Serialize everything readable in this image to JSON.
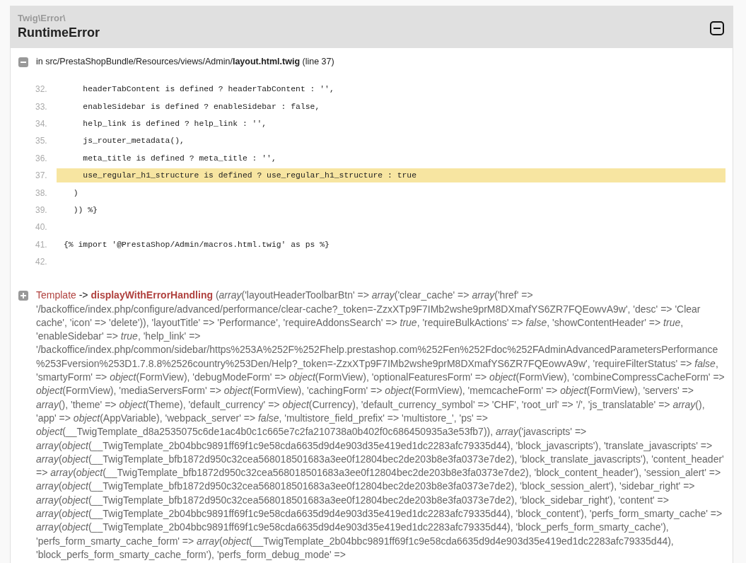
{
  "exception": {
    "namespace": "Twig\\Error\\",
    "class": "RuntimeError",
    "expanded": true
  },
  "trace": [
    {
      "kind": "file",
      "expanded": true,
      "location": "in src/PrestaShopBundle/Resources/views/Admin/**layout.html.twig** (line 37)",
      "code": [
        {
          "number": "32.",
          "text": "    headerTabContent is defined ? headerTabContent : '',",
          "selected": false
        },
        {
          "number": "33.",
          "text": "    enableSidebar is defined ? enableSidebar : false,",
          "selected": false
        },
        {
          "number": "34.",
          "text": "    help_link is defined ? help_link : '',",
          "selected": false
        },
        {
          "number": "35.",
          "text": "    js_router_metadata(),",
          "selected": false
        },
        {
          "number": "36.",
          "text": "    meta_title is defined ? meta_title : '',",
          "selected": false
        },
        {
          "number": "37.",
          "text": "    use_regular_h1_structure is defined ? use_regular_h1_structure : true",
          "selected": true
        },
        {
          "number": "38.",
          "text": "  )",
          "selected": false
        },
        {
          "number": "39.",
          "text": "  )) %}",
          "selected": false
        },
        {
          "number": "40.",
          "selected": false
        },
        {
          "number": "41.",
          "text": "{% import '@PrestaShop/Admin/macros.html.twig' as ps %}",
          "selected": false
        },
        {
          "number": "42.",
          "selected": false
        }
      ]
    },
    {
      "kind": "call",
      "expanded": false,
      "class": "Template",
      "arrow": "->",
      "method": "displayWithErrorHandling",
      "args": "(*array*('layoutHeaderToolbarBtn' => *array*('clear_cache' => *array*('href' => '/backoffice/index.php/configure/advanced/performance/clear-cache?_token=-ZzxXTp9F7IMb2wshe9prM8DXmafYS6ZR7FQEowvA9w', 'desc' => 'Clear cache', 'icon' => 'delete')), 'layoutTitle' => 'Performance', 'requireAddonsSearch' => *true*, 'requireBulkActions' => *false*, 'showContentHeader' => *true*, 'enableSidebar' => *true*, 'help_link' => '/backoffice/index.php/common/sidebar/https%253A%252F%252Fhelp.prestashop.com%252Fen%252Fdoc%252FAdminAdvancedParametersPerformance%253Fversion%253D1.7.8.8%2526country%253Den/Help?_token=-ZzxXTp9F7IMb2wshe9prM8DXmafYS6ZR7FQEowvA9w', 'requireFilterStatus' => *false*, 'smartyForm' => *object*(FormView), 'debugModeForm' => *object*(FormView), 'optionalFeaturesForm' => *object*(FormView), 'combineCompressCacheForm' => *object*(FormView), 'mediaServersForm' => *object*(FormView), 'cachingForm' => *object*(FormView), 'memcacheForm' => *object*(FormView), 'servers' => *array*(), 'theme' => *object*(Theme), 'default_currency' => *object*(Currency), 'default_currency_symbol' => 'CHF', 'root_url' => '/', 'js_translatable' => *array*(), 'app' => *object*(AppVariable), 'webpack_server' => *false*, 'multistore_field_prefix' => 'multistore_', 'ps' => *object*(__TwigTemplate_d8a2535075c6de1ac4b0c1c665e7c2fa210738a0b402f0c686450935a3e53fb7)), *array*('javascripts' => *array*(*object*(__TwigTemplate_2b04bbc9891ff69f1c9e58cda6635d9d4e903d35e419ed1dc2283afc79335d44), 'block_javascripts'), 'translate_javascripts' => *array*(*object*(__TwigTemplate_bfb1872d950c32cea568018501683a3ee0f12804bec2de203b8e3fa0373e7de2), 'block_translate_javascripts'), 'content_header' => *array*(*object*(__TwigTemplate_bfb1872d950c32cea568018501683a3ee0f12804bec2de203b8e3fa0373e7de2), 'block_content_header'), 'session_alert' => *array*(*object*(__TwigTemplate_bfb1872d950c32cea568018501683a3ee0f12804bec2de203b8e3fa0373e7de2), 'block_session_alert'), 'sidebar_right' => *array*(*object*(__TwigTemplate_bfb1872d950c32cea568018501683a3ee0f12804bec2de203b8e3fa0373e7de2), 'block_sidebar_right'), 'content' => *array*(*object*(__TwigTemplate_2b04bbc9891ff69f1c9e58cda6635d9d4e903d35e419ed1dc2283afc79335d44), 'block_content'), 'perfs_form_smarty_cache' => *array*(*object*(__TwigTemplate_2b04bbc9891ff69f1c9e58cda6635d9d4e903d35e419ed1dc2283afc79335d44), 'block_perfs_form_smarty_cache'), 'perfs_form_smarty_cache_form' => *array*(*object*(__TwigTemplate_2b04bbc9891ff69f1c9e58cda6635d9d4e903d35e419ed1dc2283afc79335d44), 'block_perfs_form_smarty_cache_form'), 'perfs_form_debug_mode' =>"
    }
  ]
}
